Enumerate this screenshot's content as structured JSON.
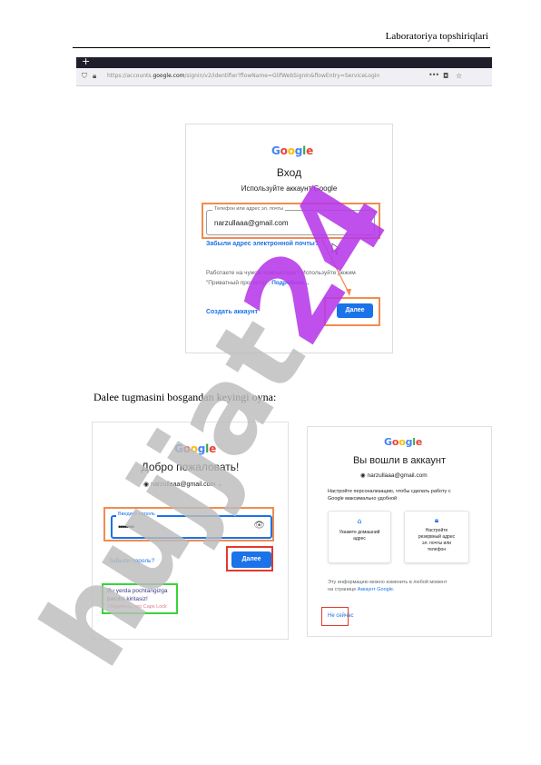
{
  "header": {
    "title": "Laboratoriya topshiriqlari"
  },
  "browser": {
    "tab_plus": "+",
    "url_prefix": "https://accounts.",
    "url_domain": "google.com",
    "url_rest": "/signin/v2/identifier?flowName=GlifWebSignIn&flowEntry=ServiceLogin",
    "menu": "•••"
  },
  "logo": [
    "G",
    "o",
    "o",
    "g",
    "l",
    "e"
  ],
  "card1": {
    "title": "Вход",
    "subtitle": "Используйте аккаунт Google",
    "field_label": "Телефон или адрес эл. почты",
    "field_value": "narzullaaa@gmail.com",
    "forgot_email": "Забыли адрес электронной почты?",
    "guest_text": "Работаете на чужом компьютере? Используйте режим",
    "guest_text2": "\"Приватный просмотр\".",
    "more": "Подробнее...",
    "create": "Создать аккаунт",
    "next": "Далее"
  },
  "caption": "Dalee tugmasini bosgandan keyingi oyna:",
  "card2": {
    "title": "Добро пожаловать!",
    "account": "narzullaaa@gmail.com",
    "pw_label": "Введите пароль",
    "pw_value": "••••••••",
    "forgot": "Забыли пароль?",
    "next": "Далее",
    "note_line1": "Bu yerda pochtangizga",
    "note_line2": "parolni kiritasiz!",
    "note_line3": "Убедитесь, что Caps Lock"
  },
  "card3": {
    "title": "Вы вошли в аккаунт",
    "account": "narzullaaa@gmail.com",
    "desc1": "Настройте персонализацию, чтобы сделать работу с",
    "desc2": "Google максимально удобной",
    "tile1": [
      "Укажите домашний",
      "адрес"
    ],
    "tile2": [
      "Настройте",
      "резервный адрес",
      "эл. почты или",
      "телефон"
    ],
    "info1": "Эту информацию можно изменить в любой момент",
    "info2_pre": "на странице ",
    "info2_link": "Аккаунт Google",
    "info2_post": ".",
    "not_now": "Не сейчас"
  },
  "watermark": "hujjat24",
  "colors": {
    "accent": "#1a73e8",
    "orange": "#f28c4f",
    "red": "#e23a2e",
    "green": "#39d43b",
    "watermark": "#cfcfcf",
    "watermark_24": "#b638e8"
  }
}
